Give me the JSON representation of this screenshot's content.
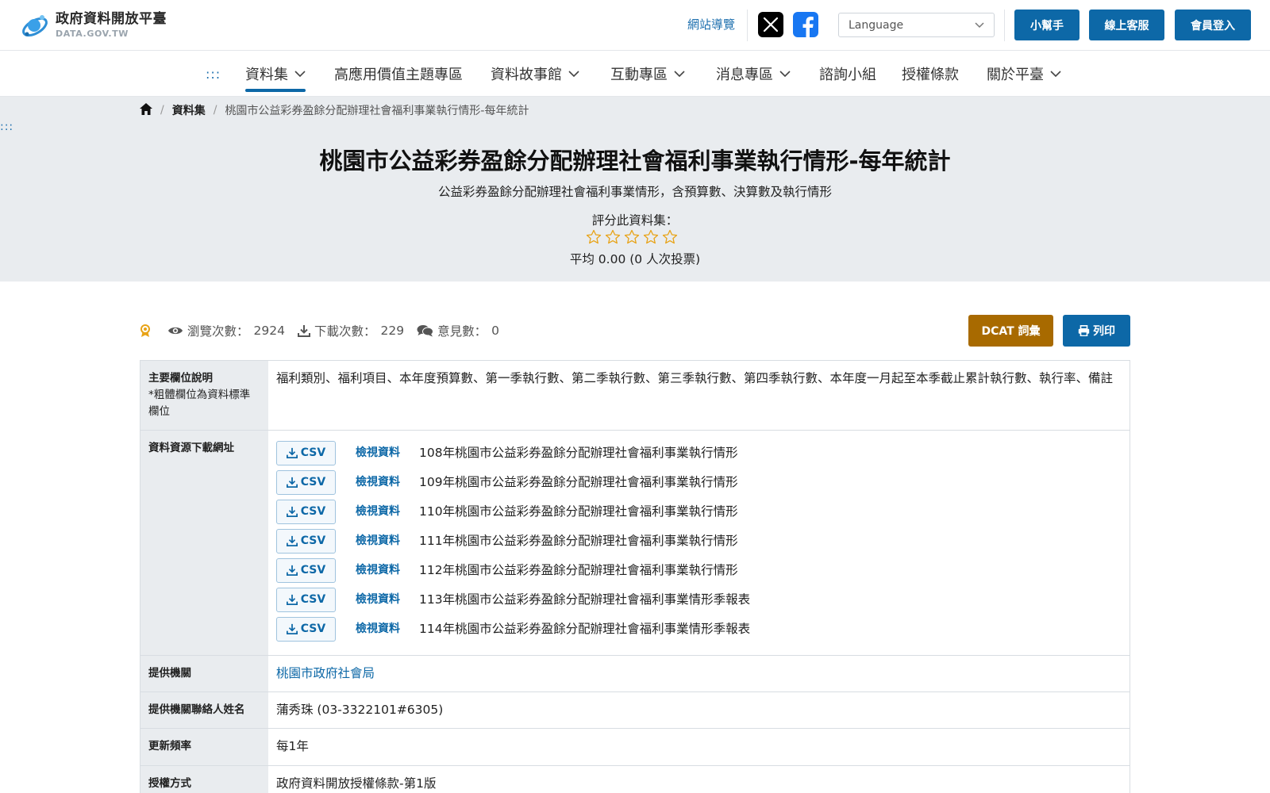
{
  "header": {
    "logo_title": "政府資料開放平臺",
    "logo_sub": "DATA.GOV.TW",
    "sitemap": "網站導覽",
    "language_placeholder": "Language",
    "buttons": [
      "小幫手",
      "線上客服",
      "會員登入"
    ]
  },
  "nav": {
    "anchor": ":::",
    "items": [
      {
        "label": "資料集"
      },
      {
        "label": "高應用價值主題專區"
      },
      {
        "label": "資料故事館"
      },
      {
        "label": "互動專區"
      },
      {
        "label": "消息專區"
      },
      {
        "label": "諮詢小組"
      },
      {
        "label": "授權條款"
      },
      {
        "label": "關於平臺"
      }
    ]
  },
  "breadcrumb": {
    "section": "資料集",
    "current": "桃園市公益彩券盈餘分配辦理社會福利事業執行情形-每年統計"
  },
  "side_anchor": ":::",
  "dataset": {
    "title": "桃園市公益彩券盈餘分配辦理社會福利事業執行情形-每年統計",
    "description": "公益彩券盈餘分配辦理社會福利事業情形，含預算數、決算數及執行情形",
    "rate_label": "評分此資料集：",
    "rating": 0,
    "rating_max": 5,
    "average_text": "平均 0.00 (0 人次投票)"
  },
  "stats": {
    "views_label": "瀏覽次數：",
    "views": "2924",
    "downloads_label": "下載次數：",
    "downloads": "229",
    "comments_label": "意見數：",
    "comments": "0"
  },
  "actions": {
    "dcat": "DCAT 詞彙",
    "print": "列印"
  },
  "table": {
    "fields_label": "主要欄位說明",
    "fields_note": "*粗體欄位為資料標準欄位",
    "fields_value": "福利類別、福利項目、本年度預算數、第一季執行數、第二季執行數、第三季執行數、第四季執行數、本年度一月起至本季截止累計執行數、執行率、備註",
    "resources_label": "資料資源下載網址",
    "csv_label": "CSV",
    "view_label": "檢視資料",
    "resources": [
      "108年桃園市公益彩券盈餘分配辦理社會福利事業執行情形",
      "109年桃園市公益彩券盈餘分配辦理社會福利事業執行情形",
      "110年桃園市公益彩券盈餘分配辦理社會福利事業執行情形",
      "111年桃園市公益彩券盈餘分配辦理社會福利事業執行情形",
      "112年桃園市公益彩券盈餘分配辦理社會福利事業執行情形",
      "113年桃園市公益彩券盈餘分配辦理社會福利事業情形季報表",
      "114年桃園市公益彩券盈餘分配辦理社會福利事業情形季報表"
    ],
    "provider_label": "提供機關",
    "provider_value": "桃園市政府社會局",
    "contact_label": "提供機關聯絡人姓名",
    "contact_value": "蒲秀珠 (03-3322101#6305)",
    "frequency_label": "更新頻率",
    "frequency_value": "每1年",
    "license_label": "授權方式",
    "license_value": "政府資料開放授權條款-第1版"
  },
  "colors": {
    "primary": "#0d68a7",
    "dcat": "#a86a00",
    "star": "#e8a317",
    "hero_bg": "#e9ecef"
  }
}
